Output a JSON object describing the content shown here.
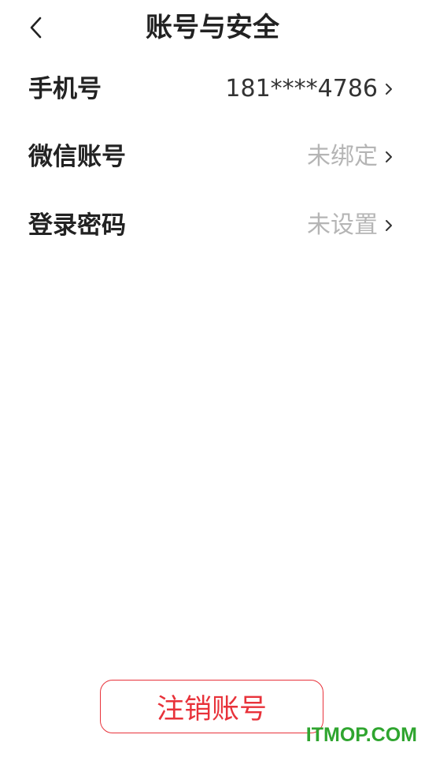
{
  "header": {
    "title": "账号与安全",
    "back_icon": "chevron-left-icon"
  },
  "rows": [
    {
      "label": "手机号",
      "value": "181****4786",
      "value_state": "set"
    },
    {
      "label": "微信账号",
      "value": "未绑定",
      "value_state": "unset"
    },
    {
      "label": "登录密码",
      "value": "未设置",
      "value_state": "unset"
    }
  ],
  "footer": {
    "deregister_label": "注销账号"
  },
  "watermark": {
    "text": "ITMOP.COM"
  },
  "colors": {
    "accent_red": "#e8323a",
    "text_dark": "#222222",
    "text_muted": "#b5b5b5",
    "watermark_green": "#2fa52f"
  }
}
